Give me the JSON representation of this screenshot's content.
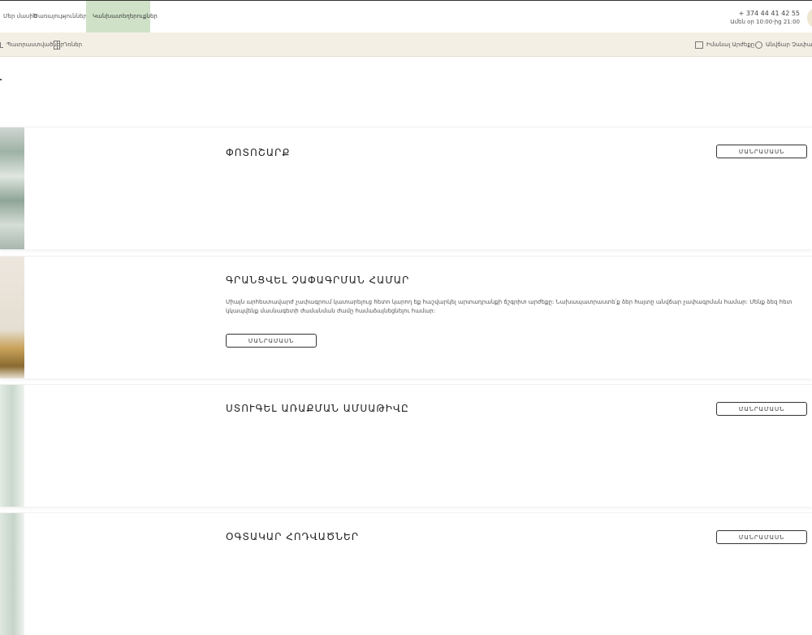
{
  "nav": {
    "tabs": [
      {
        "label": "Մեր մասին"
      },
      {
        "label": "Ծառայություններ"
      },
      {
        "label": "Կանխատեղերուքներ"
      }
    ],
    "phone": "+ 374 44 41 42 55",
    "hours": "Ամեն օր 10:00-ից 21:00"
  },
  "subbar": {
    "left": [
      {
        "label": "Պատրաստվածներ",
        "icon": "hook-icon"
      },
      {
        "label": "Դռներ",
        "icon": "cabinet-icon"
      }
    ],
    "right": [
      {
        "label": "Իմանալ Արժեքը",
        "icon": "image-icon"
      },
      {
        "label": "Անվճար Չափագրում",
        "icon": "circle-icon"
      }
    ]
  },
  "cards": [
    {
      "title": "ՓՈՏՈՇԱՐՔ",
      "button": "ՄԱՆՐԱՄԱՍՆ",
      "desc": ""
    },
    {
      "title": "ԳՐԱՆՑՎԵԼ ՉԱՓԱԳՐՄԱՆ ՀԱՄԱՐ",
      "button": "ՄԱՆՐԱՄԱՍՆ",
      "desc": "Միայն արհեստավարժ չափագրում կատարելուց հետո կարող եք հաշվարկել արտադրանքի ճշգրիտ արժեքը: Նախապատրաստե՛ք ձեր հայտը անվճար չափագրման համար: Մենք ձեզ հետ կկապվենք մասնագետի ժամանման ժամը համաձայնեցնելու համար:"
    },
    {
      "title": "ՍՏՈՒԳԵԼ ԱՌԱՔՄԱՆ ԱՄՍԱԹԻՎԸ",
      "button": "ՄԱՆՐԱՄԱՍՆ",
      "desc": ""
    },
    {
      "title": "ՕԳՏԱԿԱՐ ՀՈԴՎԱԾՆԵՐ",
      "button": "ՄԱՆՐԱՄԱՍՆ",
      "desc": ""
    }
  ]
}
